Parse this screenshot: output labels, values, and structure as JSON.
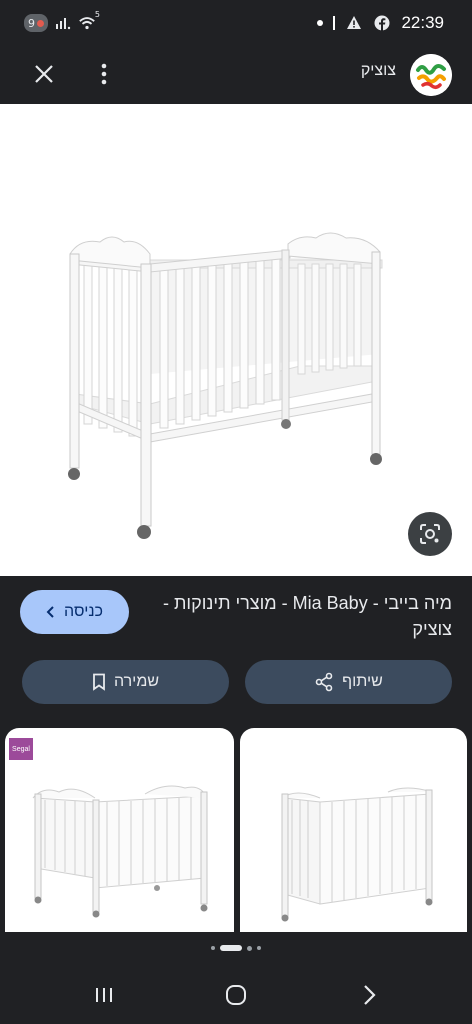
{
  "status_bar": {
    "notification_count": "9",
    "signal_label": "5",
    "time": "22:39"
  },
  "header": {
    "site_name": "צוציק",
    "logo_text": "צוציק"
  },
  "result": {
    "title": "מיה בייבי - Mia Baby - מוצרי תינוקות - צוציק",
    "visit_label": "כניסה",
    "share_label": "שיתוף",
    "save_label": "שמירה"
  },
  "thumbnails": [
    {
      "badge": "Segal"
    },
    {}
  ],
  "icons": {
    "close": "close-icon",
    "more": "more-vert-icon",
    "lens": "lens-icon",
    "share": "share-icon",
    "bookmark": "bookmark-icon",
    "chevron": "chevron-right-icon",
    "nav_recents": "recents-icon",
    "nav_home": "home-icon",
    "nav_back": "back-icon"
  },
  "colors": {
    "background": "#202124",
    "visit_button": "#a8c7fa",
    "action_button": "#3c4b5e"
  },
  "pager": {
    "total": 5,
    "active": 2
  }
}
